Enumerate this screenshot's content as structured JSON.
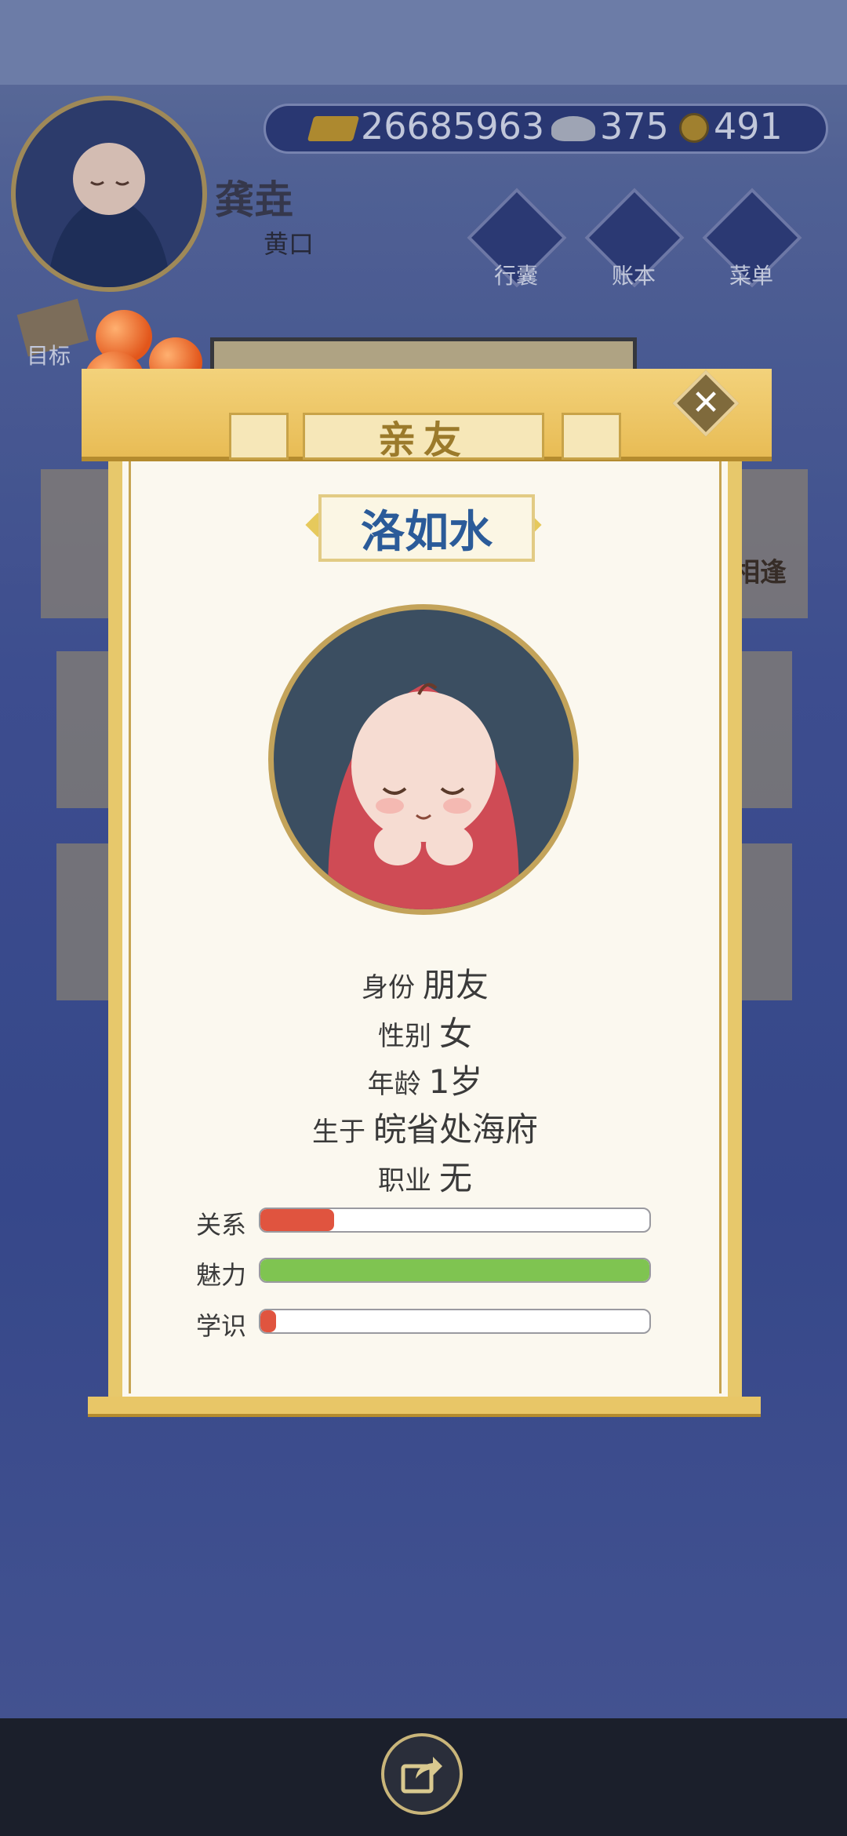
{
  "header": {
    "player_name": "龚垚",
    "player_title": "黄口",
    "gold": "26685963",
    "silver": "375",
    "coins": "491"
  },
  "menu": {
    "bag": "行囊",
    "ledger": "账本",
    "menu": "菜单",
    "goal": "目标"
  },
  "background": {
    "partial_text": "相逢"
  },
  "dialog": {
    "title": "亲友",
    "name": "洛如水",
    "info": [
      {
        "label": "身份",
        "value": "朋友"
      },
      {
        "label": "性别",
        "value": "女"
      },
      {
        "label": "年龄",
        "value": "1岁"
      },
      {
        "label": "生于",
        "value": "皖省处海府"
      },
      {
        "label": "职业",
        "value": "无"
      }
    ],
    "stats": [
      {
        "label": "关系",
        "value": 0.19,
        "color": "#e0543f"
      },
      {
        "label": "魅力",
        "value": 1.0,
        "color": "#7fc451"
      },
      {
        "label": "学识",
        "value": 0.04,
        "color": "#e0543f"
      }
    ]
  }
}
